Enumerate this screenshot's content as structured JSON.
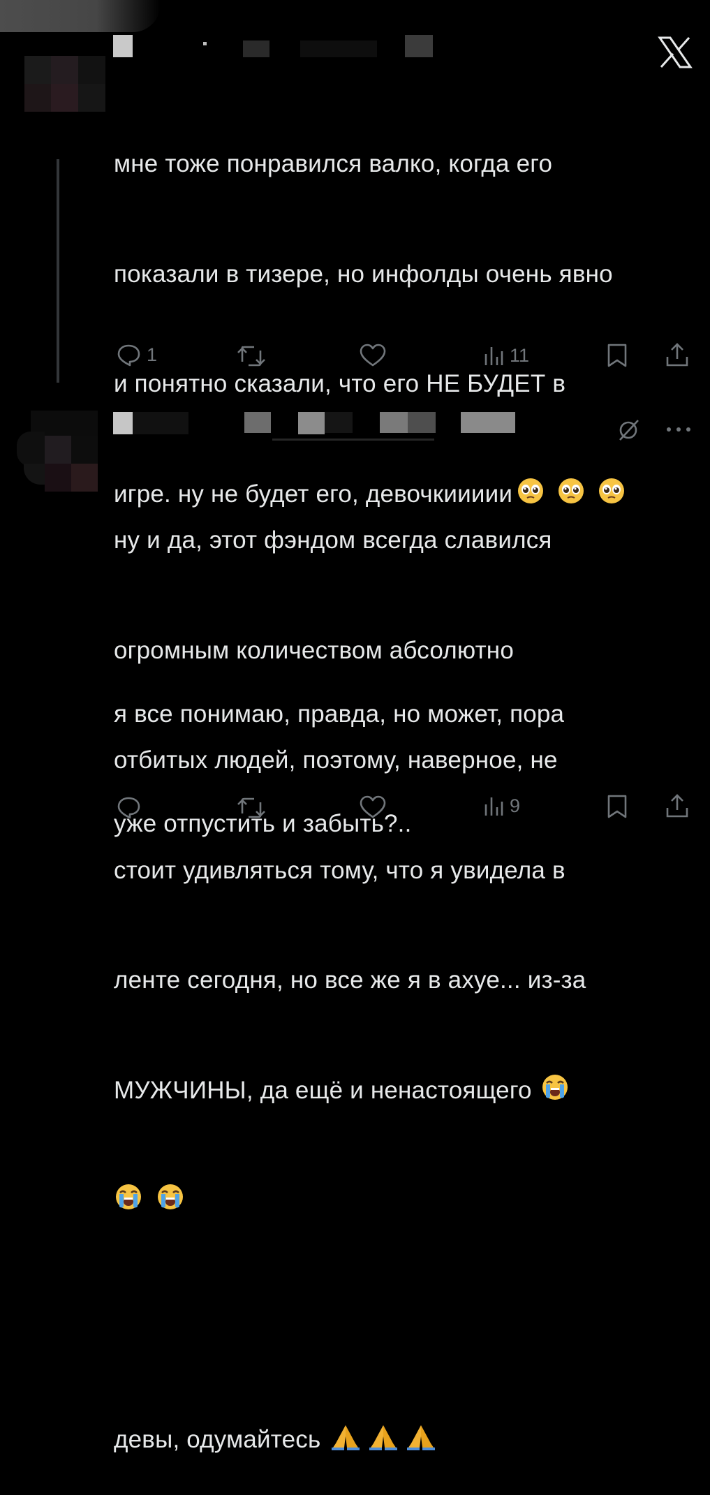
{
  "app": {
    "logo_icon": "x-logo-icon"
  },
  "colors": {
    "text": "#e7e9ea",
    "secondary": "#71767b",
    "background": "#000000"
  },
  "post1": {
    "text_lines": [
      "мне тоже понравился валко, когда его",
      "показали в тизере, но инфолды очень явно",
      "и понятно сказали, что его НЕ БУДЕТ в",
      "игре. ну не будет его, девочкиииии",
      "",
      "я все понимаю, правда, но может, пора",
      "уже отпустить и забыть?.."
    ],
    "emoji_icon": "pleading-face-icon",
    "stats": {
      "replies": "1",
      "retweets": "",
      "likes": "",
      "views": "11"
    }
  },
  "post2": {
    "text_lines": [
      "ну и да, этот фэндом всегда славился",
      "огромным количеством абсолютно",
      "отбитых людей, поэтому, наверное, не",
      "стоит удивляться тому, что я увидела в",
      "ленте сегодня, но все же я в ахуе... из-за",
      "МУЖЧИНЫ, да ещё и ненастоящего",
      "",
      "",
      "девы, одумайтесь"
    ],
    "emoji_cry_icon": "loudly-crying-face-icon",
    "emoji_pray_icon": "folded-hands-icon",
    "stats": {
      "replies": "",
      "retweets": "",
      "likes": "",
      "views": "9"
    },
    "header_icons": [
      "grok-icon",
      "more-icon"
    ]
  }
}
